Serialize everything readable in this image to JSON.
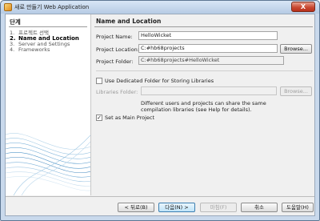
{
  "window": {
    "title": "새로 만들기 Web Application",
    "close_glyph": "X"
  },
  "steps": {
    "title": "단계",
    "items": [
      {
        "num": "1.",
        "label": "프로젝트 선택",
        "current": false
      },
      {
        "num": "2.",
        "label": "Name and Location",
        "current": true
      },
      {
        "num": "3.",
        "label": "Server and Settings",
        "current": false
      },
      {
        "num": "4.",
        "label": "Frameworks",
        "current": false
      }
    ]
  },
  "pane": {
    "title": "Name and Location",
    "project_name_label": "Project Name:",
    "project_name_value": "HelloWicket",
    "project_location_label": "Project Location:",
    "project_location_value": "C:#hb68projects",
    "browse_label": "Browse...",
    "project_folder_label": "Project Folder:",
    "project_folder_value": "C:#hb68projects#HelloWicket",
    "dedicated_folder_label": "Use Dedicated Folder for Storing Libraries",
    "dedicated_folder_checked": false,
    "libraries_folder_label": "Libraries Folder:",
    "libraries_folder_value": "",
    "libraries_browse_label": "Browse...",
    "libraries_note_line1": "Different users and projects can share the same",
    "libraries_note_line2": "compilation libraries (see Help for details).",
    "main_project_label": "Set as Main Project",
    "main_project_checked": true
  },
  "footer": {
    "back_label": "< 뒤로(B)",
    "next_label": "다음(N) >",
    "finish_label": "마침(F)",
    "cancel_label": "취소",
    "help_label": "도움말(H)"
  }
}
